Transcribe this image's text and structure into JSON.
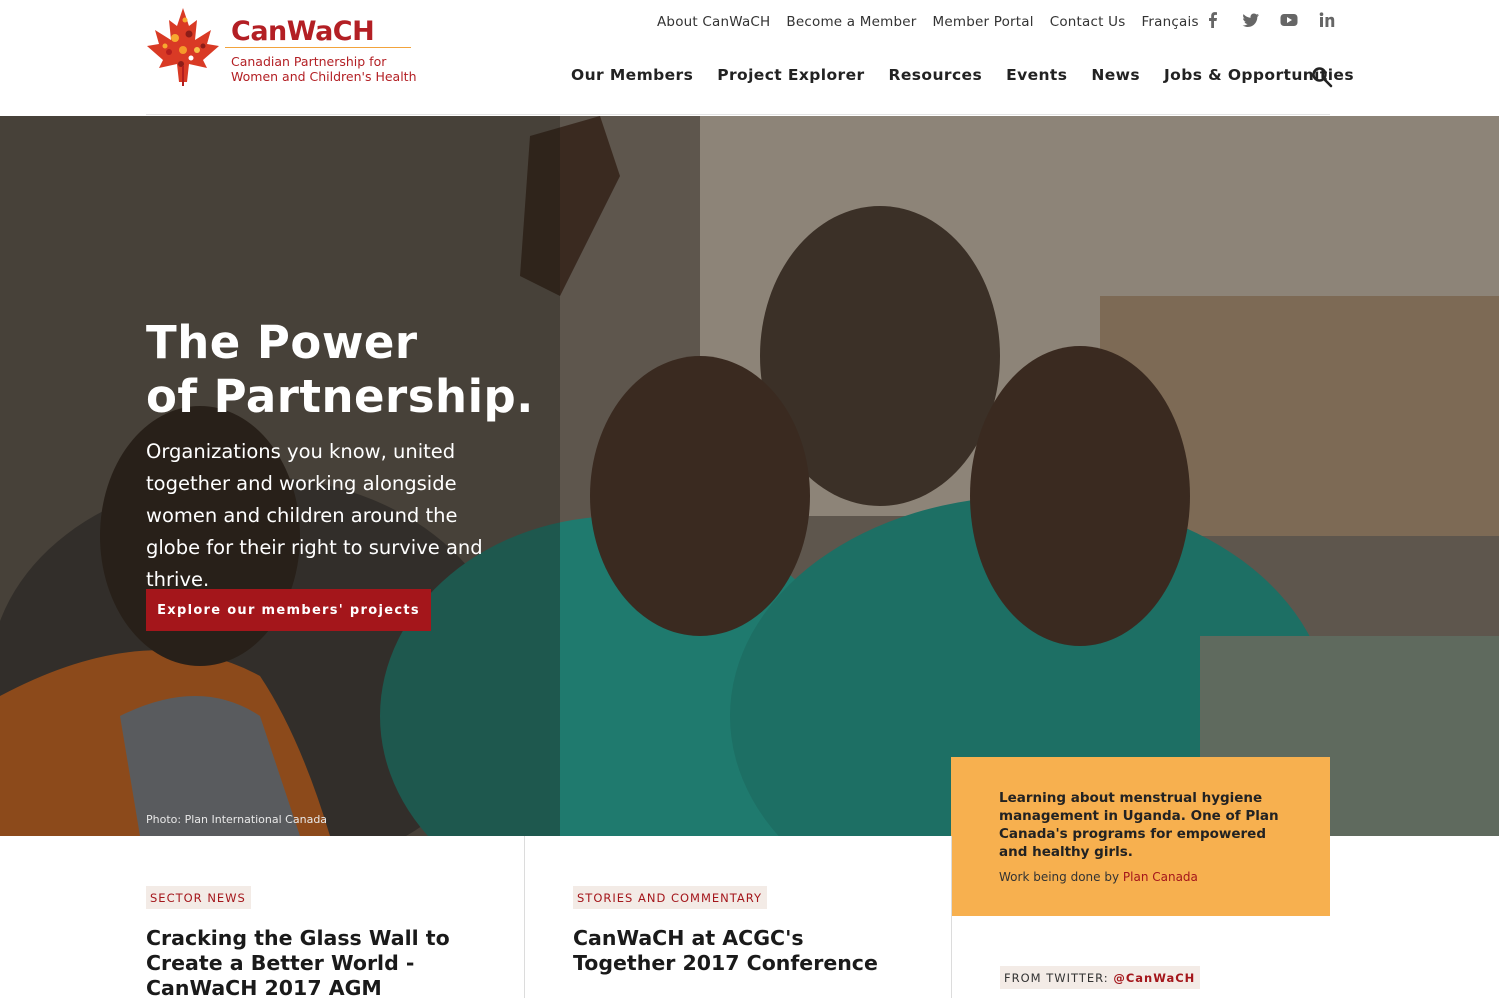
{
  "brand": {
    "name": "CanWaCH",
    "subtitle_line1": "Canadian Partnership for",
    "subtitle_line2": "Women and Children's Health",
    "color": "#b31f24"
  },
  "top_nav": [
    "About CanWaCH",
    "Become a Member",
    "Member Portal",
    "Contact Us",
    "Français"
  ],
  "social_icons": [
    "facebook-icon",
    "twitter-icon",
    "youtube-icon",
    "linkedin-icon"
  ],
  "main_nav": [
    "Our Members",
    "Project Explorer",
    "Resources",
    "Events",
    "News",
    "Jobs & Opportunities"
  ],
  "hero": {
    "title_line1": "The Power",
    "title_line2": "of Partnership.",
    "subtitle": "Organizations you know, united together and working alongside women and children around the globe for their right to survive and thrive.",
    "cta_label": "Explore our members' projects",
    "photo_credit": "Photo: Plan International Canada"
  },
  "callout": {
    "text": "Learning about menstrual hygiene management in Uganda. One of Plan Canada's programs for empowered and healthy girls.",
    "credit_prefix": "Work being done by",
    "credit_link": "Plan Canada",
    "background": "#f7b04f"
  },
  "articles": [
    {
      "tag": "SECTOR NEWS",
      "title": "Cracking the Glass Wall to Create a Better World - CanWaCH 2017 AGM"
    },
    {
      "tag": "STORIES AND COMMENTARY",
      "title": "CanWaCH at ACGC's Together 2017 Conference"
    }
  ],
  "twitter": {
    "prefix": "FROM TWITTER:",
    "handle": "@CanWaCH"
  },
  "colors": {
    "accent": "#a4161b",
    "tag_bg": "#f3ebe6"
  }
}
